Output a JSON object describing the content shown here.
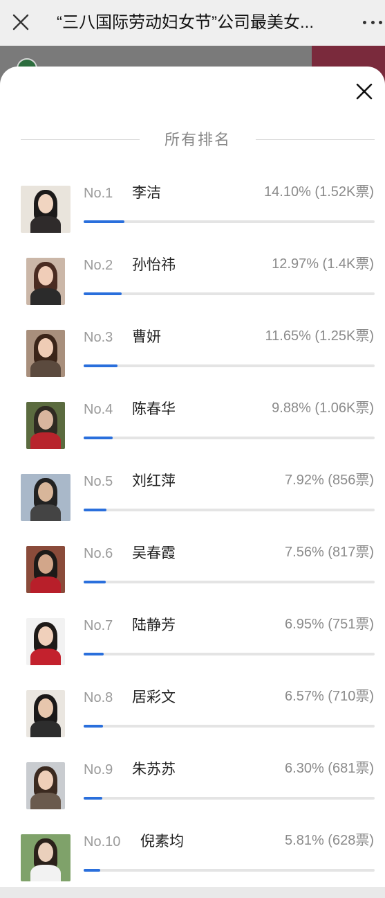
{
  "header": {
    "title": "“三八国际劳动妇女节”公司最美女..."
  },
  "panel": {
    "section_title": "所有排名"
  },
  "ranking": [
    {
      "no": "No.1",
      "name": "李洁",
      "stat": "14.10% (1.52K票)",
      "percent": 14.1
    },
    {
      "no": "No.2",
      "name": "孙怡祎",
      "stat": "12.97% (1.4K票)",
      "percent": 12.97
    },
    {
      "no": "No.3",
      "name": "曹妍",
      "stat": "11.65% (1.25K票)",
      "percent": 11.65
    },
    {
      "no": "No.4",
      "name": "陈春华",
      "stat": "9.88% (1.06K票)",
      "percent": 9.88
    },
    {
      "no": "No.5",
      "name": "刘红萍",
      "stat": "7.92% (856票)",
      "percent": 7.92
    },
    {
      "no": "No.6",
      "name": "吴春霞",
      "stat": "7.56% (817票)",
      "percent": 7.56
    },
    {
      "no": "No.7",
      "name": "陆静芳",
      "stat": "6.95% (751票)",
      "percent": 6.95
    },
    {
      "no": "No.8",
      "name": "居彩文",
      "stat": "6.57% (710票)",
      "percent": 6.57
    },
    {
      "no": "No.9",
      "name": "朱苏苏",
      "stat": "6.30% (681票)",
      "percent": 6.3
    },
    {
      "no": "No.10",
      "name": "倪素均",
      "stat": "5.81% (628票)",
      "percent": 5.81
    }
  ],
  "colors": {
    "progress": "#2a6fdc",
    "track": "#e4e4e4"
  },
  "icons": {
    "top_close": "close-icon",
    "more": "more-icon",
    "sheet_close": "close-icon"
  }
}
